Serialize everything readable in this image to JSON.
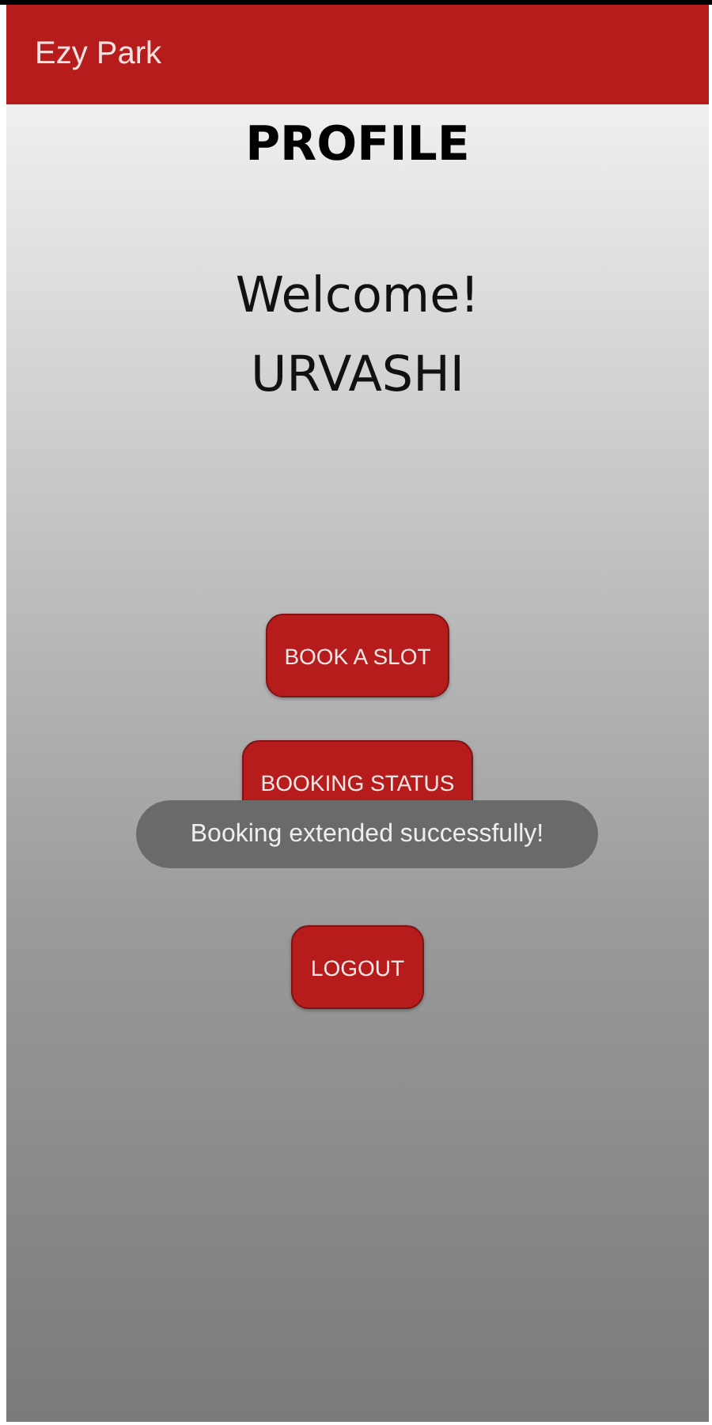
{
  "app_bar": {
    "title": "Ezy Park"
  },
  "heading": "PROFILE",
  "welcome": "Welcome!",
  "user_name": "URVASHI",
  "buttons": [
    {
      "label": "BOOK A SLOT"
    },
    {
      "label": "BOOKING STATUS"
    },
    {
      "label": "LOGOUT"
    }
  ],
  "toast": {
    "message": "Booking extended successfully!"
  }
}
